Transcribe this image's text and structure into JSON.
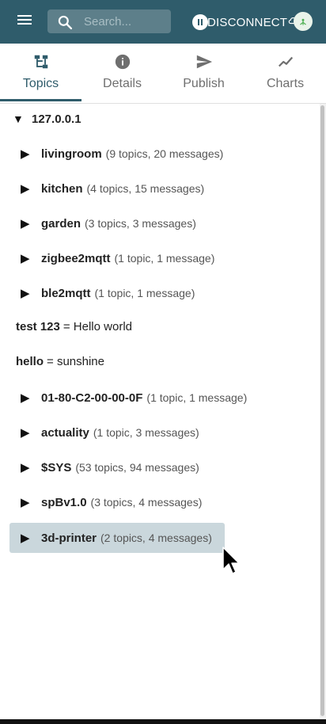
{
  "appbar": {
    "menu_icon": "hamburger-menu-icon",
    "search_placeholder": "Search...",
    "disconnect_label": "DISCONNECT"
  },
  "tabs": [
    {
      "label": "Topics",
      "icon": "topics-icon",
      "active": true
    },
    {
      "label": "Details",
      "icon": "info-icon",
      "active": false
    },
    {
      "label": "Publish",
      "icon": "send-icon",
      "active": false
    },
    {
      "label": "Charts",
      "icon": "chart-line-icon",
      "active": false
    }
  ],
  "tree": {
    "root": {
      "label": "127.0.0.1",
      "expanded": true
    },
    "items": [
      {
        "type": "node",
        "name": "livingroom",
        "meta": "(9 topics, 20 messages)"
      },
      {
        "type": "node",
        "name": "kitchen",
        "meta": "(4 topics, 15 messages)"
      },
      {
        "type": "node",
        "name": "garden",
        "meta": "(3 topics, 3 messages)"
      },
      {
        "type": "node",
        "name": "zigbee2mqtt",
        "meta": "(1 topic, 1 message)"
      },
      {
        "type": "node",
        "name": "ble2mqtt",
        "meta": "(1 topic, 1 message)"
      },
      {
        "type": "value",
        "key": "test 123",
        "value": "= Hello world"
      },
      {
        "type": "value",
        "key": "hello",
        "value": "= sunshine"
      },
      {
        "type": "node",
        "name": "01-80-C2-00-00-0F",
        "meta": "(1 topic, 1 message)"
      },
      {
        "type": "node",
        "name": "actuality",
        "meta": "(1 topic, 3 messages)"
      },
      {
        "type": "node",
        "name": "$SYS",
        "meta": "(53 topics, 94 messages)"
      },
      {
        "type": "node",
        "name": "spBv1.0",
        "meta": "(3 topics, 4 messages)"
      },
      {
        "type": "node",
        "name": "3d-printer",
        "meta": "(2 topics, 4 messages)",
        "selected": true
      }
    ]
  },
  "colors": {
    "appbar": "#2f5c6b",
    "selected_row": "#cad7dc",
    "tab_active": "#2f5c6b",
    "tab_inactive": "#6f6f6f"
  }
}
